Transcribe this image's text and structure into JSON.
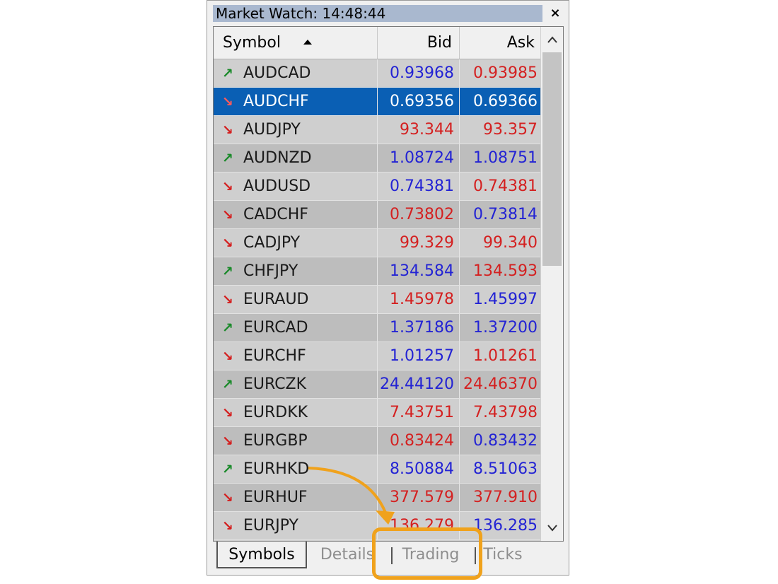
{
  "window": {
    "title": "Market Watch: 14:48:44",
    "close_label": "×"
  },
  "columns": {
    "symbol": "Symbol",
    "bid": "Bid",
    "ask": "Ask"
  },
  "rows": [
    {
      "symbol": "AUDCAD",
      "trend": "up",
      "bid": "0.93968",
      "bid_color": "blue",
      "ask": "0.93985",
      "ask_color": "red",
      "selected": false
    },
    {
      "symbol": "AUDCHF",
      "trend": "down",
      "bid": "0.69356",
      "bid_color": "white",
      "ask": "0.69366",
      "ask_color": "white",
      "selected": true
    },
    {
      "symbol": "AUDJPY",
      "trend": "down",
      "bid": "93.344",
      "bid_color": "red",
      "ask": "93.357",
      "ask_color": "red",
      "selected": false
    },
    {
      "symbol": "AUDNZD",
      "trend": "up",
      "bid": "1.08724",
      "bid_color": "blue",
      "ask": "1.08751",
      "ask_color": "blue",
      "selected": false
    },
    {
      "symbol": "AUDUSD",
      "trend": "down",
      "bid": "0.74381",
      "bid_color": "blue",
      "ask": "0.74381",
      "ask_color": "red",
      "selected": false
    },
    {
      "symbol": "CADCHF",
      "trend": "down",
      "bid": "0.73802",
      "bid_color": "red",
      "ask": "0.73814",
      "ask_color": "blue",
      "selected": false
    },
    {
      "symbol": "CADJPY",
      "trend": "down",
      "bid": "99.329",
      "bid_color": "red",
      "ask": "99.340",
      "ask_color": "red",
      "selected": false
    },
    {
      "symbol": "CHFJPY",
      "trend": "up",
      "bid": "134.584",
      "bid_color": "blue",
      "ask": "134.593",
      "ask_color": "red",
      "selected": false
    },
    {
      "symbol": "EURAUD",
      "trend": "down",
      "bid": "1.45978",
      "bid_color": "red",
      "ask": "1.45997",
      "ask_color": "blue",
      "selected": false
    },
    {
      "symbol": "EURCAD",
      "trend": "up",
      "bid": "1.37186",
      "bid_color": "blue",
      "ask": "1.37200",
      "ask_color": "blue",
      "selected": false
    },
    {
      "symbol": "EURCHF",
      "trend": "down",
      "bid": "1.01257",
      "bid_color": "blue",
      "ask": "1.01261",
      "ask_color": "red",
      "selected": false
    },
    {
      "symbol": "EURCZK",
      "trend": "up",
      "bid": "24.44120",
      "bid_color": "blue",
      "ask": "24.46370",
      "ask_color": "red",
      "selected": false
    },
    {
      "symbol": "EURDKK",
      "trend": "down",
      "bid": "7.43751",
      "bid_color": "red",
      "ask": "7.43798",
      "ask_color": "red",
      "selected": false
    },
    {
      "symbol": "EURGBP",
      "trend": "down",
      "bid": "0.83424",
      "bid_color": "red",
      "ask": "0.83432",
      "ask_color": "blue",
      "selected": false
    },
    {
      "symbol": "EURHKD",
      "trend": "up",
      "bid": "8.50884",
      "bid_color": "blue",
      "ask": "8.51063",
      "ask_color": "blue",
      "selected": false
    },
    {
      "symbol": "EURHUF",
      "trend": "down",
      "bid": "377.579",
      "bid_color": "red",
      "ask": "377.910",
      "ask_color": "red",
      "selected": false
    },
    {
      "symbol": "EURJPY",
      "trend": "down",
      "bid": "136.279",
      "bid_color": "red",
      "ask": "136.285",
      "ask_color": "blue",
      "selected": false
    }
  ],
  "tabs": [
    {
      "label": "Symbols",
      "active": true
    },
    {
      "label": "Details",
      "active": false
    },
    {
      "label": "Trading",
      "active": false
    },
    {
      "label": "Ticks",
      "active": false
    }
  ],
  "icons": {
    "sort": "sort-ascending-icon",
    "trend_up": "arrow-up-right-icon",
    "trend_down": "arrow-down-right-icon",
    "scroll_up": "chevron-up-icon",
    "scroll_down": "chevron-down-icon"
  },
  "colors": {
    "title_bar": "#a9b8cf",
    "selection": "#0a5fb4",
    "price_up": "#2323d4",
    "price_down": "#d42020",
    "trend_up": "#1a8a2a",
    "trend_down": "#d42020",
    "callout": "#f0a21c"
  }
}
